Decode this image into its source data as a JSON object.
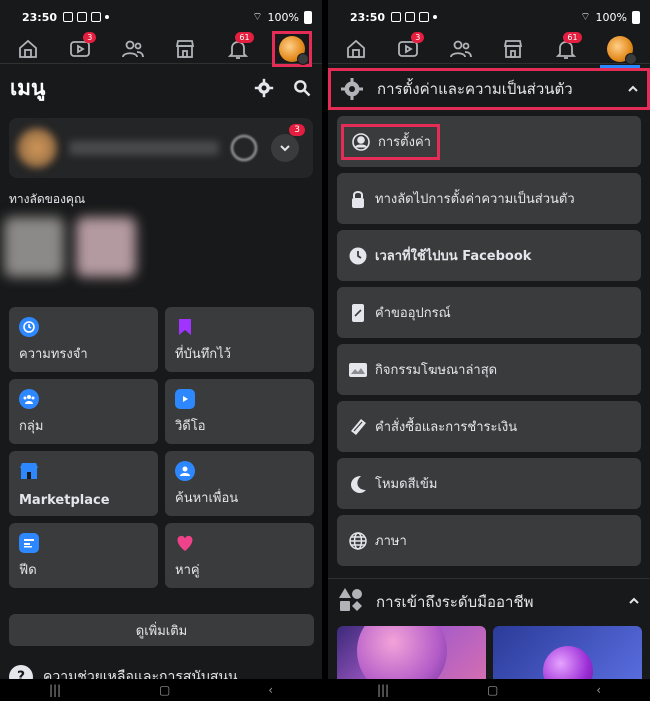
{
  "status": {
    "time": "23:50",
    "battery": "100%"
  },
  "left": {
    "nav_badges": {
      "watch": "3",
      "notifications": "61"
    },
    "menu_title": "เมนู",
    "profile_badge": "3",
    "shortcuts_label": "ทางลัดของคุณ",
    "tiles": [
      {
        "label": "ความทรงจำ",
        "icon": "clock-icon",
        "color": "#2d88ff"
      },
      {
        "label": "ที่บันทึกไว้",
        "icon": "bookmark-icon",
        "color": "#a033ff"
      },
      {
        "label": "กลุ่ม",
        "icon": "groups-icon",
        "color": "#2d88ff"
      },
      {
        "label": "วิดีโอ",
        "icon": "video-icon",
        "color": "#2d88ff"
      },
      {
        "label": "Marketplace",
        "icon": "shop-icon",
        "color": "#2d88ff"
      },
      {
        "label": "ค้นหาเพื่อน",
        "icon": "find-friends-icon",
        "color": "#2d88ff"
      },
      {
        "label": "ฟีด",
        "icon": "feed-icon",
        "color": "#2d88ff"
      },
      {
        "label": "หาคู่",
        "icon": "heart-icon",
        "color": "#f0428a"
      }
    ],
    "see_more": "ดูเพิ่มเติม",
    "help_label": "ความช่วยเหลือและการสนับสนุน"
  },
  "right": {
    "nav_badges": {
      "watch": "3",
      "notifications": "61"
    },
    "section_title": "การตั้งค่าและความเป็นส่วนตัว",
    "items": [
      {
        "label": "การตั้งค่า",
        "icon": "person-circle-icon"
      },
      {
        "label": "ทางลัดไปการตั้งค่าความเป็นส่วนตัว",
        "icon": "lock-icon"
      },
      {
        "label": "เวลาที่ใช้ไปบน Facebook",
        "icon": "clock-icon"
      },
      {
        "label": "คำขออุปกรณ์",
        "icon": "device-icon"
      },
      {
        "label": "กิจกรรมโฆษณาล่าสุด",
        "icon": "ad-activity-icon"
      },
      {
        "label": "คำสั่งซื้อและการชำระเงิน",
        "icon": "payment-icon"
      },
      {
        "label": "โหมดสีเข้ม",
        "icon": "moon-icon"
      },
      {
        "label": "ภาษา",
        "icon": "globe-icon"
      }
    ],
    "section2_title": "การเข้าถึงระดับมืออาชีพ"
  },
  "colors": {
    "highlight": "#e42c57",
    "badge": "#e41e3f",
    "accent": "#2d88ff"
  }
}
